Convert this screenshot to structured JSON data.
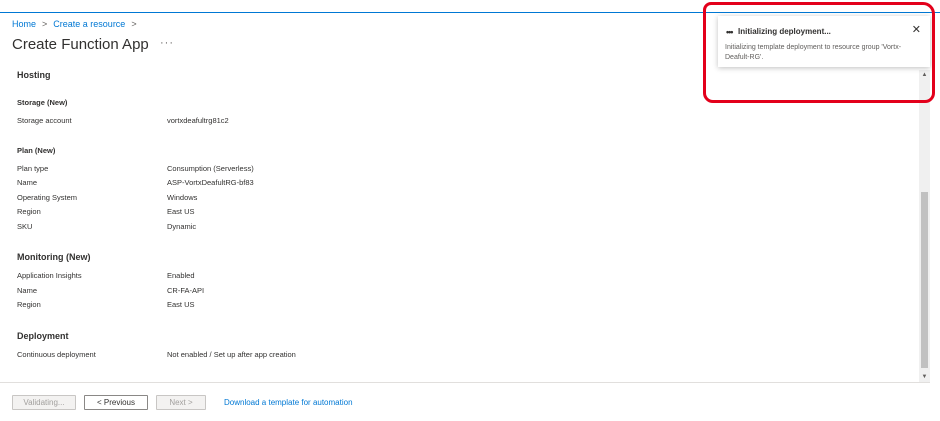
{
  "breadcrumb": {
    "home": "Home",
    "create": "Create a resource",
    "sep": ">"
  },
  "page": {
    "title": "Create Function App",
    "more": "···"
  },
  "sections": {
    "hosting": "Hosting",
    "storage": {
      "heading": "Storage (New)",
      "account_label": "Storage account",
      "account_value": "vortxdeafultrg81c2"
    },
    "plan": {
      "heading": "Plan (New)",
      "rows": [
        {
          "label": "Plan type",
          "value": "Consumption (Serverless)"
        },
        {
          "label": "Name",
          "value": "ASP-VortxDeafultRG-bf83"
        },
        {
          "label": "Operating System",
          "value": "Windows"
        },
        {
          "label": "Region",
          "value": "East US"
        },
        {
          "label": "SKU",
          "value": "Dynamic"
        }
      ]
    },
    "monitoring": {
      "heading": "Monitoring (New)",
      "rows": [
        {
          "label": "Application Insights",
          "value": "Enabled"
        },
        {
          "label": "Name",
          "value": "CR-FA-API"
        },
        {
          "label": "Region",
          "value": "East US"
        }
      ]
    },
    "deployment": {
      "heading": "Deployment",
      "rows": [
        {
          "label": "Continuous deployment",
          "value": "Not enabled / Set up after app creation"
        }
      ]
    }
  },
  "footer": {
    "validating": "Validating...",
    "previous": "< Previous",
    "next": "Next >",
    "download_link": "Download a template for automation"
  },
  "toast": {
    "dots": "•••",
    "title": "Initializing deployment...",
    "close": "✕",
    "body": "Initializing template deployment to resource group 'Vortx-Deafult-RG'."
  },
  "colors": {
    "accent": "#0078d4",
    "annotation": "#e3001b"
  }
}
